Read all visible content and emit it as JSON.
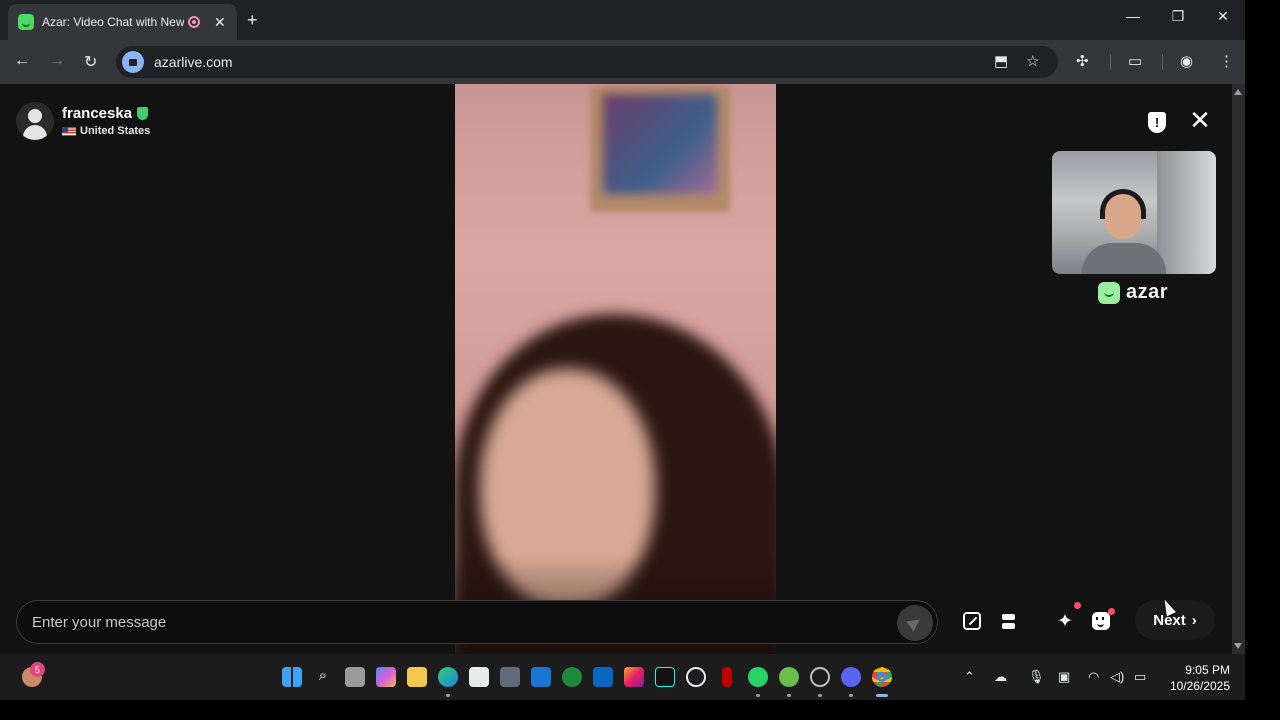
{
  "browser": {
    "tab_title": "Azar: Video Chat with New",
    "url": "azarlive.com",
    "controls": {
      "minimize": "—",
      "maximize": "❐",
      "close": "✕",
      "new_tab": "+",
      "tab_close": "✕"
    }
  },
  "chat": {
    "peer_name": "franceska",
    "peer_country": "United States",
    "brand": "azar",
    "message_placeholder": "Enter your message",
    "next_label": "Next",
    "next_chevron": "›"
  },
  "taskbar": {
    "notification_badge": "5",
    "time": "9:05 PM",
    "date": "10/26/2025"
  },
  "colors": {
    "accent_green": "#3ecf6a",
    "badge_red": "#ff4d6a",
    "page_bg": "#121212"
  },
  "icons": [
    "back-icon",
    "forward-icon",
    "reload-icon",
    "install-icon",
    "bookmark-star-icon",
    "extensions-icon",
    "media-control-icon",
    "profile-icon",
    "menu-icon",
    "report-shield-icon",
    "close-icon",
    "send-icon",
    "fullscreen-icon",
    "layout-icon",
    "sparkle-effects-icon",
    "emoji-mask-icon"
  ]
}
